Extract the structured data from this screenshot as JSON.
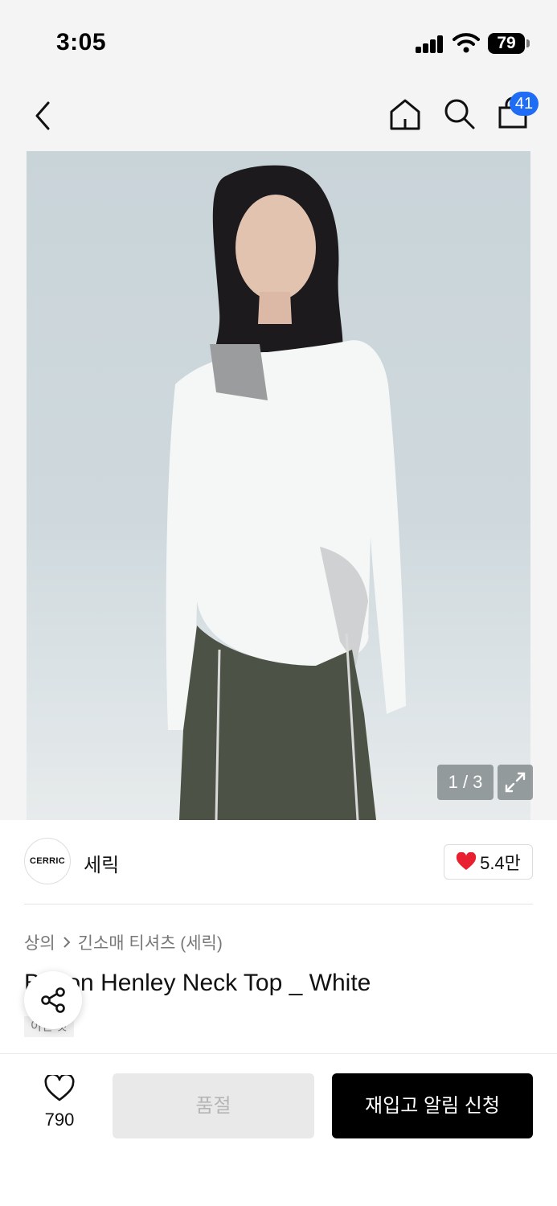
{
  "status_bar": {
    "time": "3:05",
    "battery": "79"
  },
  "nav": {
    "cart_count": "41"
  },
  "gallery": {
    "counter": "1 / 3"
  },
  "brand": {
    "logo_text": "CERRIC",
    "name": "세릭",
    "likes": "5.4만"
  },
  "breadcrumb": {
    "category": "상의",
    "subcategory": "긴소매 티셔츠 (세릭)"
  },
  "product": {
    "title": "Button Henley Neck Top _ White",
    "tag": "이번 것"
  },
  "bottom_bar": {
    "wish_count": "790",
    "soldout_label": "품절",
    "restock_label": "재입고 알림 신청"
  },
  "colors": {
    "accent_blue": "#1f6cf5",
    "heart_red": "#e8202f",
    "primary_black": "#000000"
  }
}
